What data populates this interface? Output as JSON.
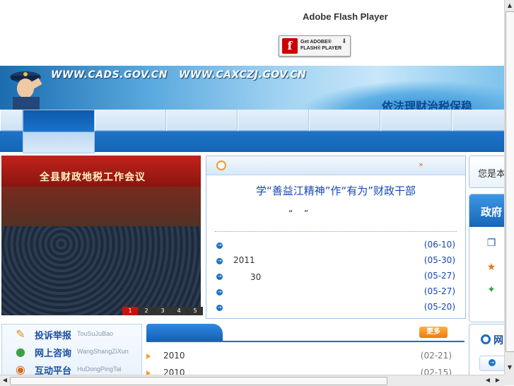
{
  "flash": {
    "title": "Adobe Flash Player",
    "badge_line1": "Get ADOBE®",
    "badge_line2": "FLASH® PLAYER"
  },
  "banner": {
    "url_text": "WWW.CADS.GOV.CN   WWW.CAXCZJ.GOV.CN",
    "slogan": "依法理财治税保稳"
  },
  "nav": {
    "cells": 7
  },
  "slider": {
    "caption": "全县财政地税工作会议",
    "pages": [
      "1",
      "2",
      "3",
      "4",
      "5"
    ],
    "active_page": "1"
  },
  "news": {
    "more": "»",
    "headline": "“　　　　”　“　　”　　　　",
    "headline_display": "学“善益江精神”作“有为”财政干部",
    "quote": "“  ”",
    "items": [
      {
        "text": "",
        "date": "(06-10)"
      },
      {
        "text": "2011",
        "date": "(05-30)"
      },
      {
        "text": "　　30",
        "date": "(05-27)"
      },
      {
        "text": "",
        "date": "(05-27)"
      },
      {
        "text": "",
        "date": "(05-20)"
      }
    ]
  },
  "welcome": {
    "text": "您是本"
  },
  "gov": {
    "title": "政府",
    "icons": [
      "copy-icon",
      "medal-icon",
      "puzzle-icon"
    ]
  },
  "quick": {
    "items": [
      {
        "label": "投诉举报",
        "pinyin": "TouSuJuBao",
        "icon": "report-icon"
      },
      {
        "label": "网上咨询",
        "pinyin": "WangShangZiXun",
        "icon": "chat-icon"
      },
      {
        "label": "互动平台",
        "pinyin": "HuDongPingTai",
        "icon": "platform-icon"
      }
    ]
  },
  "list2": {
    "more": "更多",
    "items": [
      {
        "text": "2010",
        "date": "(02-21)"
      },
      {
        "text": "2010",
        "date": "(02-15)"
      }
    ]
  },
  "net": {
    "label": "网"
  }
}
